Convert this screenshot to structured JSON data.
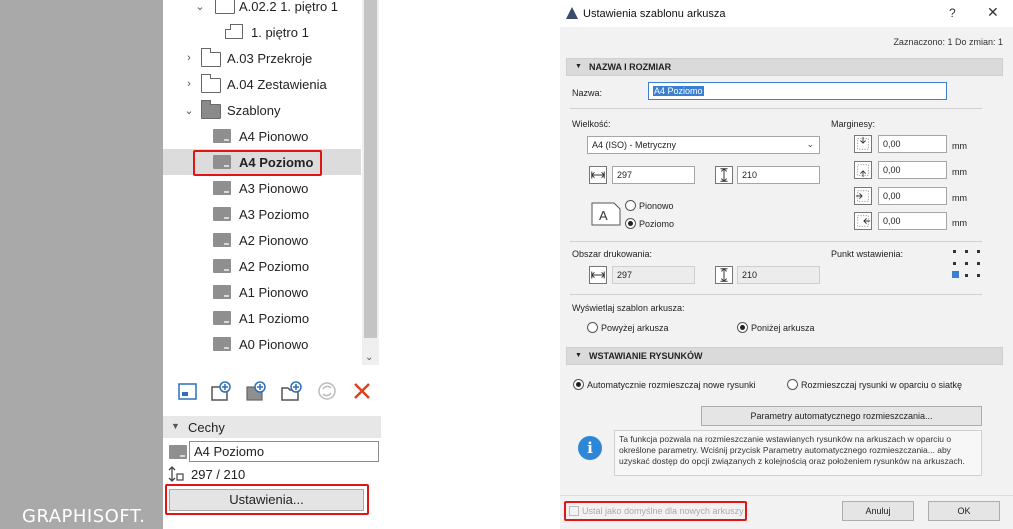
{
  "branding": {
    "logo_text": "GRAPHISOFT."
  },
  "navigator": {
    "tree": [
      {
        "label": "A.02.2 1. piętro 1",
        "icon": "folder-icon",
        "chevron": "expanded"
      },
      {
        "label": "1. piętro 1",
        "icon": "layout-page-icon",
        "chevron": ""
      },
      {
        "label": "A.03 Przekroje",
        "icon": "folder-icon",
        "chevron": "collapsed"
      },
      {
        "label": "A.04 Zestawienia",
        "icon": "folder-icon",
        "chevron": "collapsed"
      },
      {
        "label": "Szablony",
        "icon": "folder-filled-icon",
        "chevron": "expanded"
      },
      {
        "label": "A4 Pionowo",
        "icon": "master-layout-icon"
      },
      {
        "label": "A4 Poziomo",
        "icon": "master-layout-icon",
        "selected": true
      },
      {
        "label": "A3 Pionowo",
        "icon": "master-layout-icon"
      },
      {
        "label": "A3 Poziomo",
        "icon": "master-layout-icon"
      },
      {
        "label": "A2 Pionowo",
        "icon": "master-layout-icon"
      },
      {
        "label": "A2 Poziomo",
        "icon": "master-layout-icon"
      },
      {
        "label": "A1 Pionowo",
        "icon": "master-layout-icon"
      },
      {
        "label": "A1 Poziomo",
        "icon": "master-layout-icon"
      },
      {
        "label": "A0 Pionowo",
        "icon": "master-layout-icon"
      }
    ],
    "properties": {
      "header": "Cechy",
      "name_value": "A4 Poziomo",
      "size_value": "297 / 210",
      "settings_button": "Ustawienia..."
    }
  },
  "dialog": {
    "title": "Ustawienia szablonu arkusza",
    "help": "?",
    "close": "✕",
    "status": "Zaznaczono: 1 Do zmian: 1",
    "section_name_size": "NAZWA I ROZMIAR",
    "name_label": "Nazwa:",
    "name_value": "A4 Poziomo",
    "size_label": "Wielkość:",
    "size_select": "A4 (ISO) - Metryczny",
    "width_value": "297",
    "height_value": "210",
    "orientation_portrait": "Pionowo",
    "orientation_landscape": "Poziomo",
    "margins_label": "Marginesy:",
    "margins": [
      "0,00",
      "0,00",
      "0,00",
      "0,00"
    ],
    "unit": "mm",
    "print_area_label": "Obszar drukowania:",
    "print_width": "297",
    "print_height": "210",
    "anchor_label": "Punkt wstawienia:",
    "show_template_label": "Wyświetlaj szablon arkusza:",
    "above_sheet": "Powyżej arkusza",
    "below_sheet": "Poniżej arkusza",
    "section_placement": "WSTAWIANIE RYSUNKÓW",
    "auto_place": "Automatycznie rozmieszczaj nowe rysunki",
    "grid_place": "Rozmieszczaj rysunki w oparciu o siatkę",
    "auto_params_button": "Parametry automatycznego rozmieszczania...",
    "info_text": "Ta funkcja pozwala na rozmieszczanie wstawianych rysunków na arkuszach w oparciu o określone parametry. Wciśnij przycisk Parametry automatycznego rozmieszczania... aby uzyskać dostęp do opcji związanych z kolejnością oraz położeniem rysunków na arkuszach.",
    "set_default_label": "Ustal jako domyślne dla nowych arkuszy",
    "cancel_button": "Anuluj",
    "ok_button": "OK"
  },
  "colors": {
    "accent_red": "#e01515",
    "info_blue": "#2d86d6",
    "selection_blue": "#3a7fd0"
  }
}
